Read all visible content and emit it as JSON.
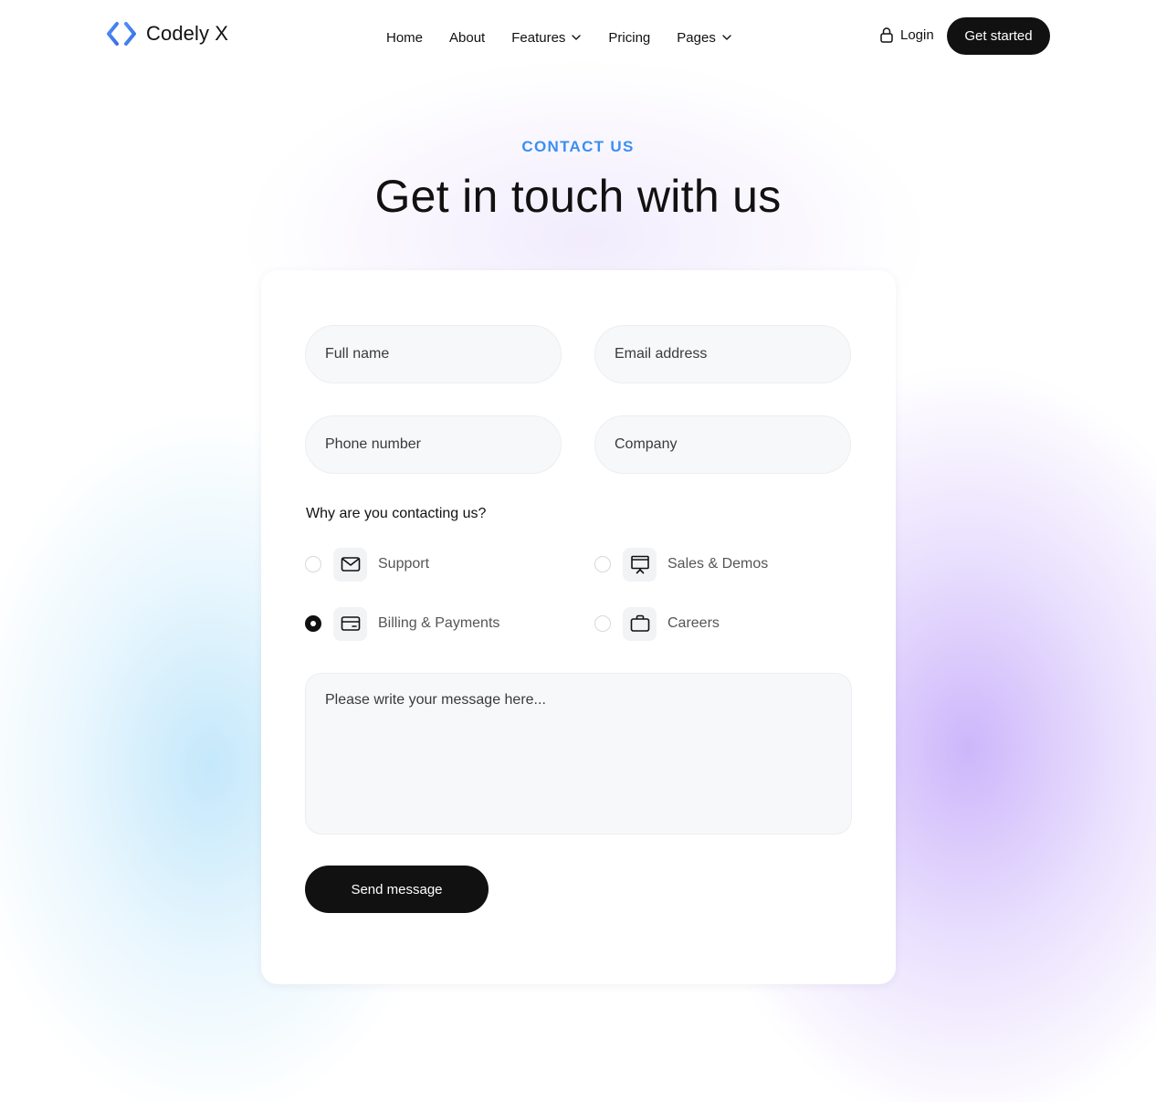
{
  "brand": {
    "name": "Codely X",
    "accent_color": "#3b8ef0",
    "logo_icon": "code-brackets-icon"
  },
  "nav": {
    "items": [
      {
        "label": "Home",
        "has_dropdown": false
      },
      {
        "label": "About",
        "has_dropdown": false
      },
      {
        "label": "Features",
        "has_dropdown": true
      },
      {
        "label": "Pricing",
        "has_dropdown": false
      },
      {
        "label": "Pages",
        "has_dropdown": true
      }
    ],
    "login_label": "Login",
    "cta_label": "Get started"
  },
  "hero": {
    "eyebrow": "CONTACT US",
    "title": "Get in touch with us"
  },
  "form": {
    "full_name_placeholder": "Full name",
    "email_placeholder": "Email address",
    "phone_placeholder": "Phone number",
    "company_placeholder": "Company",
    "question": "Why are you contacting us?",
    "options": [
      {
        "label": "Support",
        "icon": "mail-icon",
        "selected": false
      },
      {
        "label": "Sales & Demos",
        "icon": "presentation-icon",
        "selected": false
      },
      {
        "label": "Billing & Payments",
        "icon": "credit-card-icon",
        "selected": true
      },
      {
        "label": "Careers",
        "icon": "briefcase-icon",
        "selected": false
      }
    ],
    "message_placeholder": "Please write your message here...",
    "submit_label": "Send message"
  }
}
